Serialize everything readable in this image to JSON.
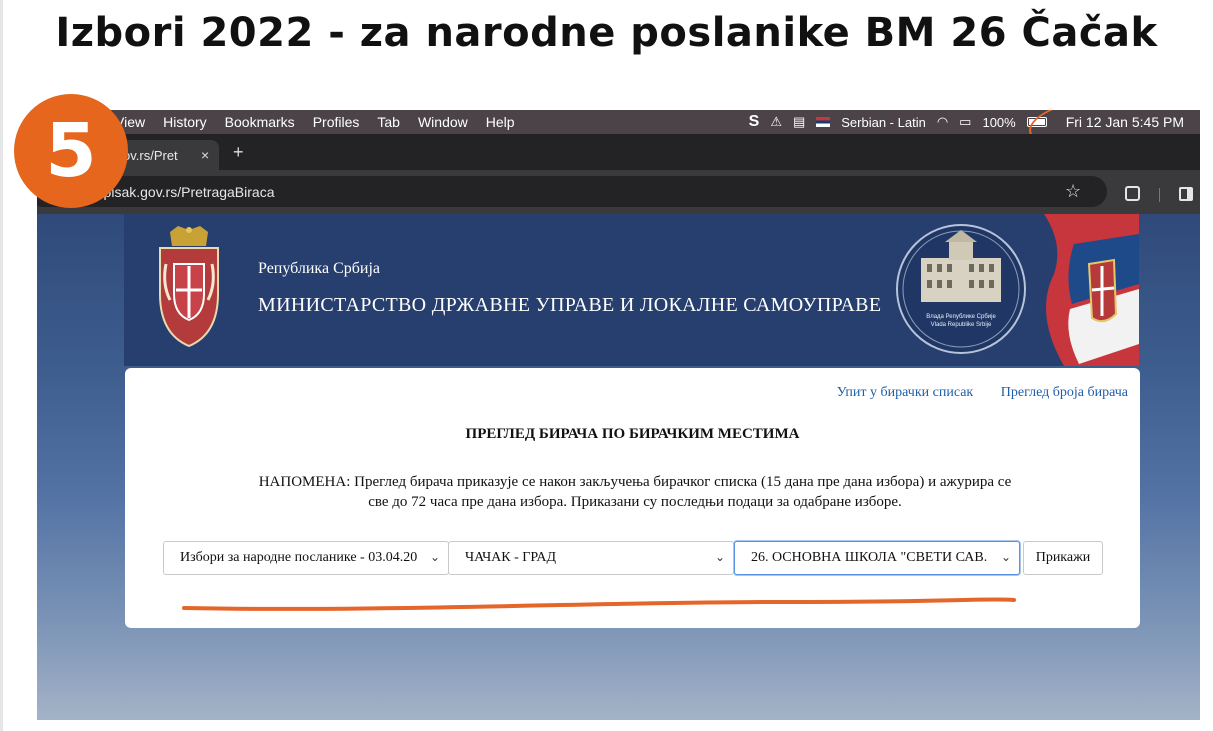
{
  "slide": {
    "title": "Izbori 2022 - za narodne poslanike BM 26 Čačak",
    "step_number": "5"
  },
  "menubar": {
    "items": [
      "View",
      "History",
      "Bookmarks",
      "Profiles",
      "Tab",
      "Window",
      "Help"
    ],
    "keyboard_layout": "Serbian - Latin",
    "battery": "100%",
    "clock": "Fri 12 Jan  5:45 PM"
  },
  "browser": {
    "tab_title": "ov.rs/Pret",
    "tab_close": "×",
    "new_tab": "+",
    "url": "rackispisak.gov.rs/PretragaBiraca",
    "star": "☆"
  },
  "gov_header": {
    "line1": "Република Србија",
    "line2": "МИНИСТАРСТВО ДРЖАВНЕ УПРАВЕ И ЛОКАЛНЕ САМОУПРАВЕ",
    "seal_text_1": "Влада Републике Србије",
    "seal_text_2": "Vlada Republike Srbije"
  },
  "panel": {
    "link_voter_query": "Упит у бирачки списак",
    "link_voter_count": "Преглед броја бирача",
    "title": "ПРЕГЛЕД БИРАЧА ПО БИРАЧКИМ МЕСТИМА",
    "note_line1": "НАПОМЕНА: Преглед бирача приказује се након закључења бирачког списка (15 дана пре дана избора) и ажурира се",
    "note_line2": "све до 72 часа пре дана избора. Приказани су последњи подаци за одабране изборе.",
    "election_select": "Избори за народне посланике - 03.04.20",
    "municipality_select": "ЧАЧАК - ГРАД",
    "polling_station_select": "26. ОСНОВНА ШКОЛА \"СВЕТИ САВ.",
    "show_button": "Прикажи"
  },
  "colors": {
    "badge": "#e5661c",
    "annotation": "#e5662b",
    "link": "#1f5ea8",
    "header_bg": "#273f6e"
  }
}
